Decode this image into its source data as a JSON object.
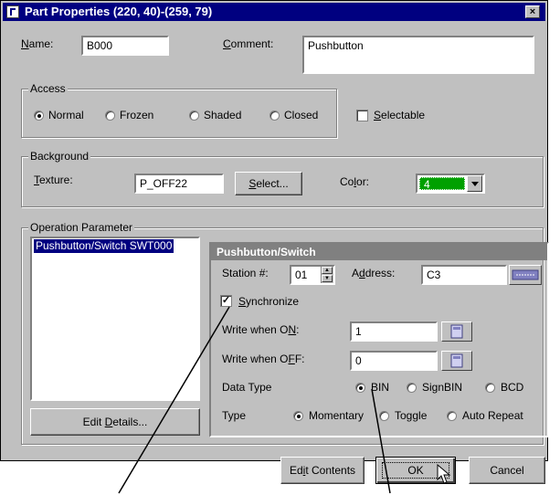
{
  "window": {
    "title": "Part Properties (220, 40)-(259, 79)",
    "close_glyph": "×"
  },
  "name": {
    "label_prefix": "",
    "label_accel": "N",
    "label_rest": "ame:",
    "value": "B000"
  },
  "comment": {
    "label_accel": "C",
    "label_rest": "omment:",
    "value": "Pushbutton"
  },
  "access": {
    "title": "Access",
    "options": [
      {
        "label": "Normal",
        "selected": true
      },
      {
        "label": "Frozen",
        "selected": false
      },
      {
        "label": "Shaded",
        "selected": false
      },
      {
        "label": "Closed",
        "selected": false
      }
    ],
    "selectable": {
      "label_accel": "S",
      "label_rest": "electable",
      "checked": false
    }
  },
  "background": {
    "title": "Background",
    "texture": {
      "label_accel": "T",
      "label_rest": "exture:",
      "value": "P_OFF22"
    },
    "select_button": {
      "label_accel": "S",
      "label_rest": "elect..."
    },
    "color": {
      "label_pre": "Co",
      "label_accel": "l",
      "label_rest": "or:",
      "value": "4",
      "swatch": "#00a000"
    }
  },
  "operation": {
    "title": "Operation Parameter",
    "list_items": [
      "Pushbutton/Switch SWT000"
    ],
    "edit_details": {
      "label_pre": "Edit ",
      "label_accel": "D",
      "label_rest": "etails..."
    },
    "panel": {
      "title": "Pushbutton/Switch",
      "station": {
        "label": "Station #:",
        "value": "01"
      },
      "address": {
        "label_pre": "A",
        "label_accel": "d",
        "label_rest": "dress:",
        "value": "C3"
      },
      "synchronize": {
        "label_accel": "S",
        "label_rest": "ynchronize",
        "checked": true
      },
      "write_on": {
        "label_pre": "Write when O",
        "label_accel": "N",
        "label_rest": ":",
        "value": "1"
      },
      "write_off": {
        "label_pre": "Write when O",
        "label_accel": "F",
        "label_rest": "F:",
        "value": "0"
      },
      "data_type": {
        "label": "Data Type",
        "options": [
          {
            "label": "BIN",
            "selected": true
          },
          {
            "label": "SignBIN",
            "selected": false
          },
          {
            "label": "BCD",
            "selected": false
          }
        ]
      },
      "type": {
        "label": "Type",
        "options": [
          {
            "label": "Momentary",
            "selected": true
          },
          {
            "label": "Toggle",
            "selected": false
          },
          {
            "label": "Auto Repeat",
            "selected": false
          }
        ]
      }
    }
  },
  "buttons": {
    "edit_contents": {
      "label_pre": "Ed",
      "label_accel": "i",
      "label_rest": "t Contents"
    },
    "ok": "OK",
    "cancel": "Cancel"
  }
}
